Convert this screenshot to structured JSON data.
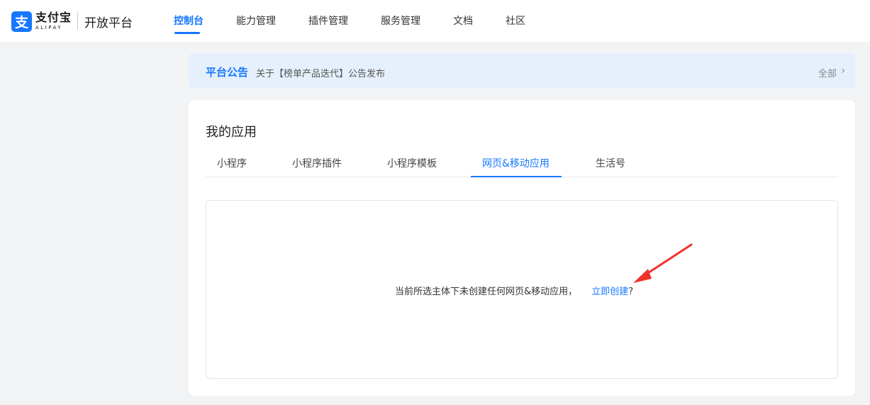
{
  "header": {
    "logo": {
      "cn": "支付宝",
      "en": "ALIPAY",
      "mark": "支"
    },
    "platform": "开放平台",
    "nav": [
      "控制台",
      "能力管理",
      "插件管理",
      "服务管理",
      "文档",
      "社区"
    ],
    "nav_active": "控制台"
  },
  "notice": {
    "title": "平台公告",
    "text": "关于【榜单产品迭代】公告发布",
    "all_label": "全部",
    "chevron": "›"
  },
  "apps": {
    "title": "我的应用",
    "tabs": [
      "小程序",
      "小程序插件",
      "小程序模板",
      "网页&移动应用",
      "生活号"
    ],
    "active_tab": "网页&移动应用",
    "empty_message": "当前所选主体下未创建任何网页&移动应用，",
    "create_link": "立即创建",
    "question_mark": "?"
  },
  "colors": {
    "accent": "#1677ff",
    "annotation_arrow": "#f0322d"
  },
  "icons": {
    "logo": "alipay-logo-icon",
    "chevron": "chevron-right-icon",
    "annotation": "red-arrow-annotation"
  }
}
